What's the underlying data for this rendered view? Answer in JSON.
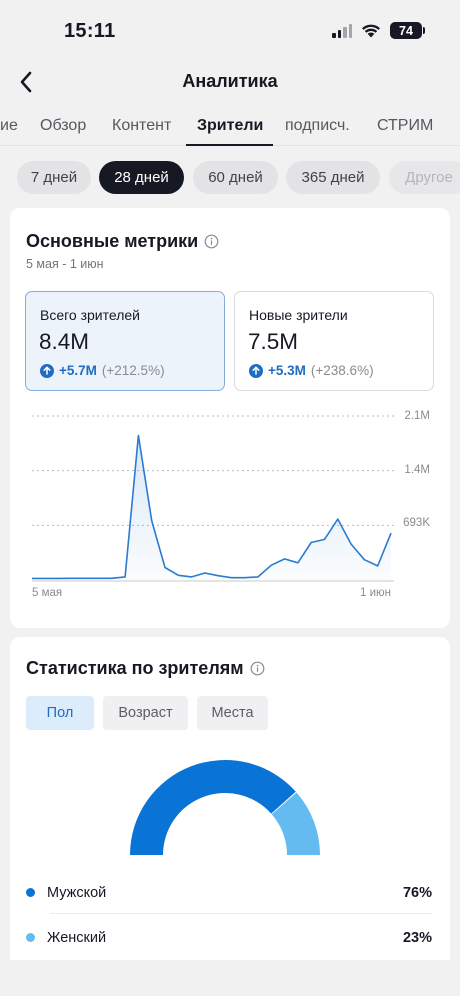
{
  "status_bar": {
    "time": "15:11",
    "battery": "74",
    "icons": [
      "signal-icon",
      "wifi-icon",
      "battery-icon"
    ]
  },
  "header": {
    "title": "Аналитика",
    "back_icon": "chevron-left-icon"
  },
  "tabs": [
    {
      "label": "ие",
      "active": false
    },
    {
      "label": "Обзор",
      "active": false
    },
    {
      "label": "Контент",
      "active": false
    },
    {
      "label": "Зрители",
      "active": true
    },
    {
      "label": "подписч.",
      "active": false
    },
    {
      "label": "СТРИМ",
      "active": false
    }
  ],
  "ranges": [
    {
      "label": "7 дней",
      "active": false
    },
    {
      "label": "28 дней",
      "active": true
    },
    {
      "label": "60 дней",
      "active": false
    },
    {
      "label": "365 дней",
      "active": false
    },
    {
      "label": "Другое",
      "active": false
    }
  ],
  "metrics": {
    "title": "Основные метрики",
    "date_range": "5 мая - 1 июн",
    "cards": [
      {
        "label": "Всего зрителей",
        "value": "8.4M",
        "delta": "+5.7M",
        "delta_pct": "(+212.5%)",
        "selected": true
      },
      {
        "label": "Новые зрители",
        "value": "7.5M",
        "delta": "+5.3M",
        "delta_pct": "(+238.6%)",
        "selected": false
      }
    ]
  },
  "chart_data": {
    "type": "area",
    "x_start_label": "5 мая",
    "x_end_label": "1 июн",
    "y_ticks": [
      "2.1M",
      "1.4M",
      "693K"
    ],
    "ylim": [
      0,
      2100000
    ],
    "grid": true,
    "color": "#2b7bd0",
    "series": [
      {
        "values": [
          20000,
          20000,
          20000,
          22000,
          22000,
          22000,
          22000,
          40000,
          1850000,
          760000,
          160000,
          60000,
          40000,
          90000,
          55000,
          30000,
          30000,
          40000,
          190000,
          270000,
          220000,
          480000,
          520000,
          780000,
          460000,
          260000,
          180000,
          600000
        ]
      }
    ]
  },
  "audience": {
    "title": "Статистика по зрителям",
    "segments": [
      {
        "label": "Пол",
        "active": true
      },
      {
        "label": "Возраст",
        "active": false
      },
      {
        "label": "Места",
        "active": false
      }
    ],
    "gender": [
      {
        "label": "Мужской",
        "value": "76%",
        "share": 0.76,
        "color": "#0a73d6"
      },
      {
        "label": "Женский",
        "value": "23%",
        "share": 0.23,
        "color": "#63bbf0"
      }
    ]
  },
  "colors": {
    "accent": "#1f6cc2",
    "background": "#f1f1f2",
    "text": "#161823"
  }
}
